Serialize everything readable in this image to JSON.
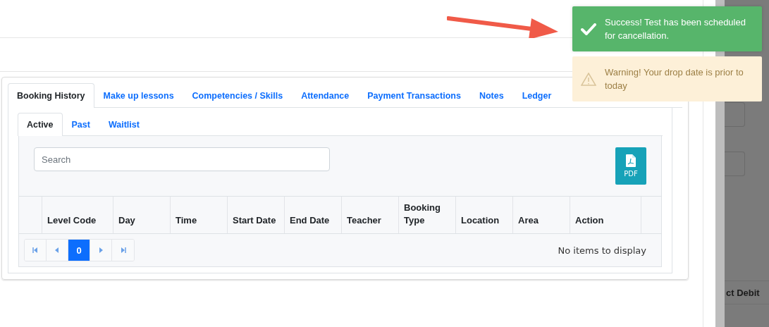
{
  "tabs": [
    {
      "label": "Booking History",
      "selected": true
    },
    {
      "label": "Make up lessons",
      "selected": false
    },
    {
      "label": "Competencies / Skills",
      "selected": false
    },
    {
      "label": "Attendance",
      "selected": false
    },
    {
      "label": "Payment Transactions",
      "selected": false
    },
    {
      "label": "Notes",
      "selected": false
    },
    {
      "label": "Ledger",
      "selected": false
    }
  ],
  "subtabs": [
    {
      "label": "Active",
      "selected": true
    },
    {
      "label": "Past",
      "selected": false
    },
    {
      "label": "Waitlist",
      "selected": false
    }
  ],
  "search": {
    "placeholder": "Search"
  },
  "pdf_button": {
    "label": "PDF"
  },
  "table": {
    "columns": [
      "Level Code",
      "Day",
      "Time",
      "Start Date",
      "End Date",
      "Teacher",
      "Booking Type",
      "Location",
      "Area",
      "Action"
    ]
  },
  "pager": {
    "pages": [
      {
        "label": "0",
        "selected": true
      }
    ],
    "empty_message": "No items to display"
  },
  "side_panel": {
    "text": "ct Debit"
  },
  "toasts": [
    {
      "kind": "success",
      "text": "Success! Test has been scheduled for cancellation."
    },
    {
      "kind": "warning",
      "text": "Warning! Your drop date is prior to today"
    }
  ]
}
